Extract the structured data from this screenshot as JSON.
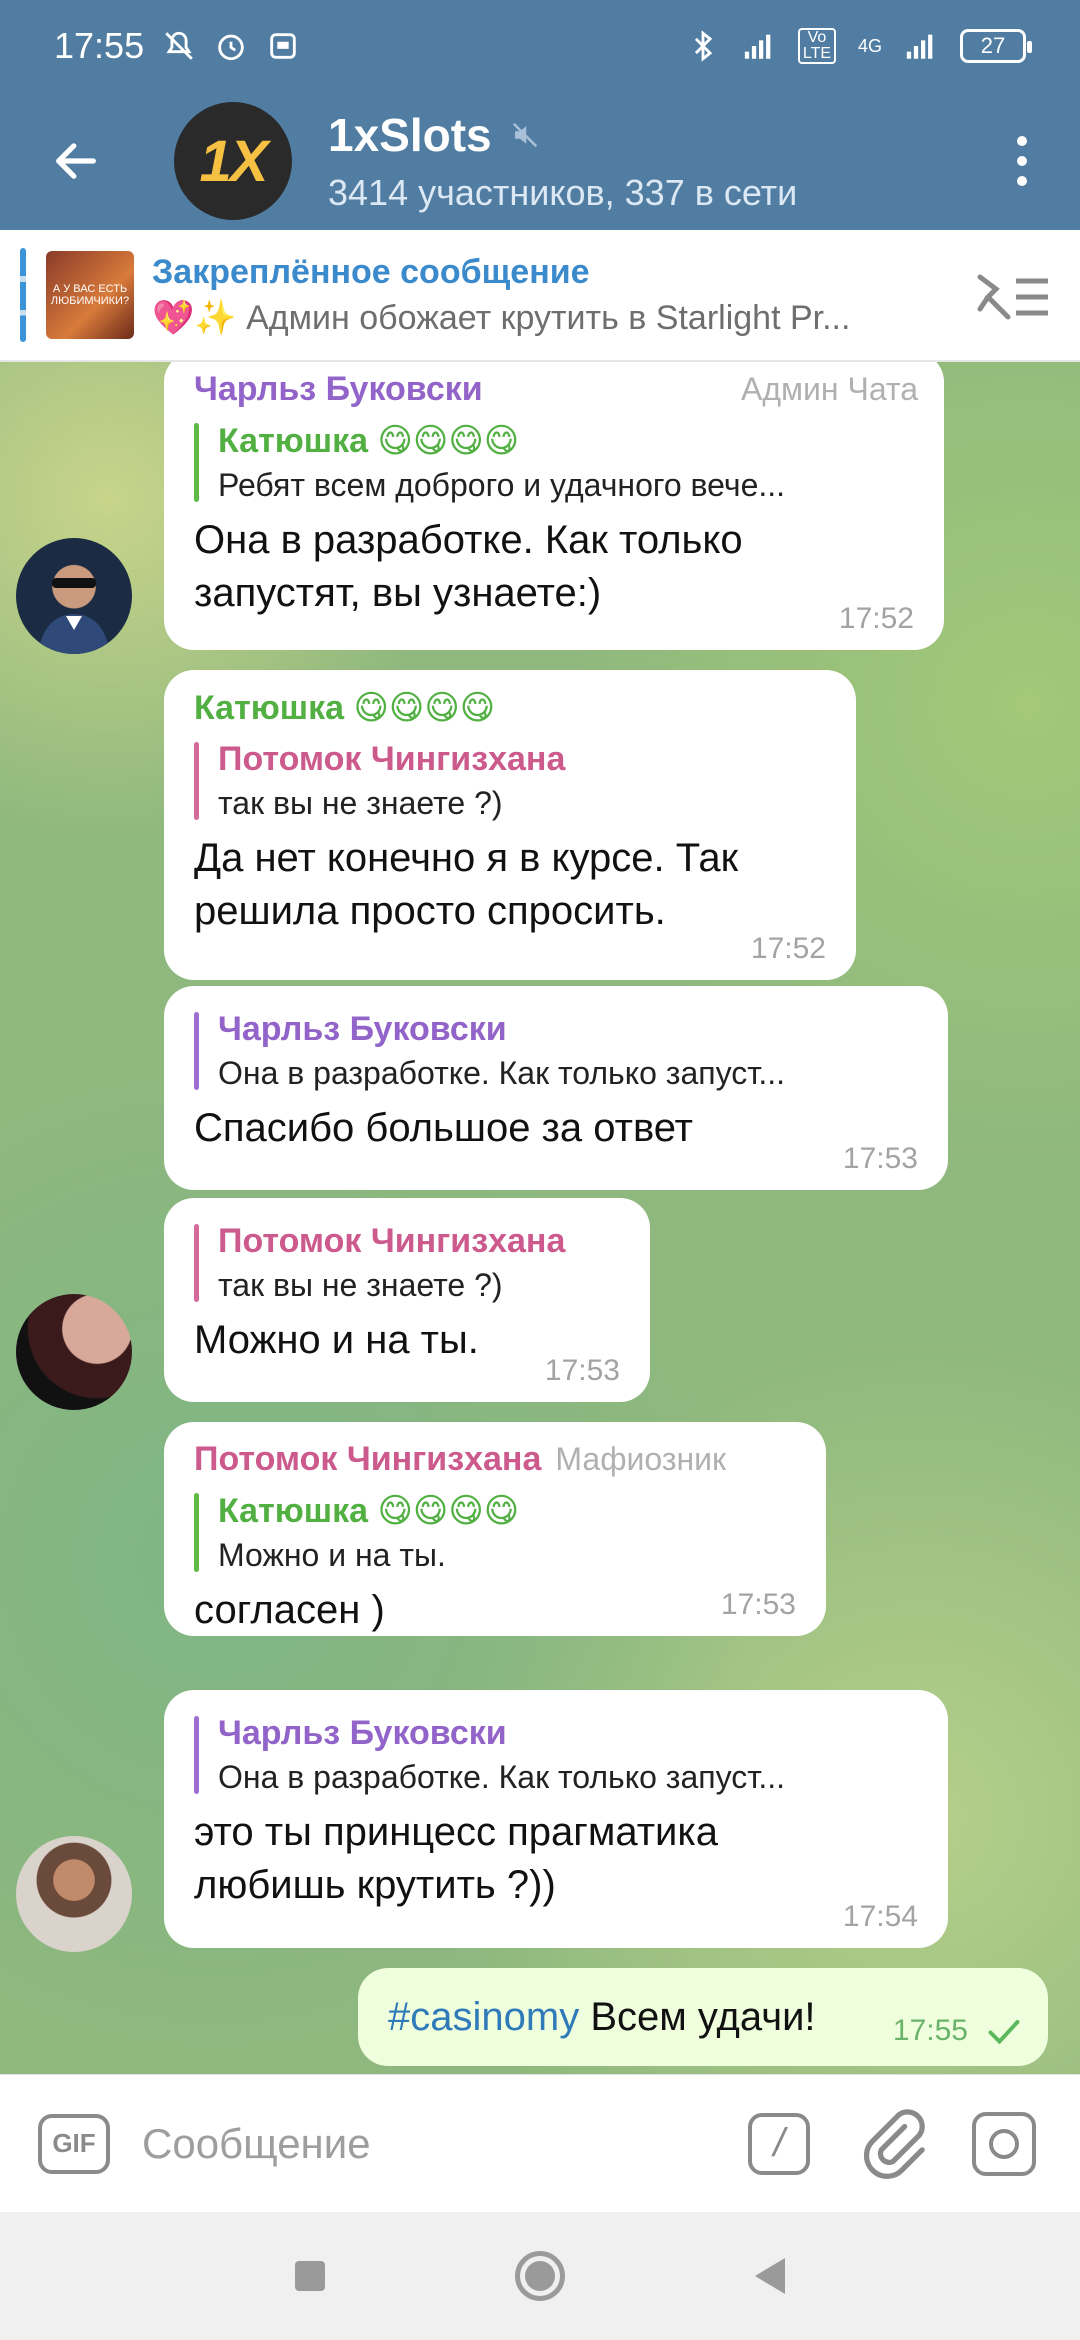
{
  "status_bar": {
    "time": "17:55",
    "battery": "27",
    "network": "4G",
    "volte": "Vo LTE"
  },
  "chat_header": {
    "title": "1xSlots",
    "subtitle": "3414 участников, 337 в сети",
    "avatar_text": "1X"
  },
  "pinned": {
    "title": "Закреплённое сообщение",
    "body": "💖✨ Админ обожает крутить в Starlight Pr...",
    "thumb_text": "А У ВАС ЕСТЬ ЛЮБИМЧИКИ?"
  },
  "messages": [
    {
      "author": "Чарльз Буковски",
      "role": "Админ Чата",
      "reply_author": "Катюшка 😋😋😋😋",
      "reply_text": "Ребят всем доброго и удачного вече...",
      "text": "Она в разработке. Как только запустят, вы узнаете:)",
      "time": "17:52"
    },
    {
      "author": "Катюшка 😋😋😋😋",
      "reply_author": "Потомок Чингизхана",
      "reply_text": "так вы не знаете  ?)",
      "text": "Да нет конечно я в курсе. Так решила просто спросить.",
      "time": "17:52"
    },
    {
      "reply_author": "Чарльз Буковски",
      "reply_text": "Она в разработке. Как только запуст...",
      "text": "Спасибо большое за ответ",
      "time": "17:53"
    },
    {
      "reply_author": "Потомок Чингизхана",
      "reply_text": "так вы не знаете  ?)",
      "text": "Можно и на ты.",
      "time": "17:53"
    },
    {
      "author": "Потомок Чингизхана",
      "role": "Мафиозник",
      "reply_author": "Катюшка 😋😋😋😋",
      "reply_text": "Можно и на ты.",
      "text": "согласен )",
      "time": "17:53"
    },
    {
      "reply_author": "Чарльз Буковски",
      "reply_text": "Она в разработке. Как только запуст...",
      "text": "это ты принцесс  прагматика любишь крутить ?))",
      "time": "17:54"
    },
    {
      "hashtag": "#casinomy",
      "text": "Всем удачи!",
      "time": "17:55"
    }
  ],
  "composer": {
    "placeholder": "Сообщение",
    "gif_label": "GIF",
    "cmd_label": "/"
  },
  "colors": {
    "header": "#517da2",
    "purple_name": "#9263c8",
    "green_name": "#52b043",
    "pink_name": "#cc5a8c",
    "outgoing_bubble": "#effedd"
  }
}
